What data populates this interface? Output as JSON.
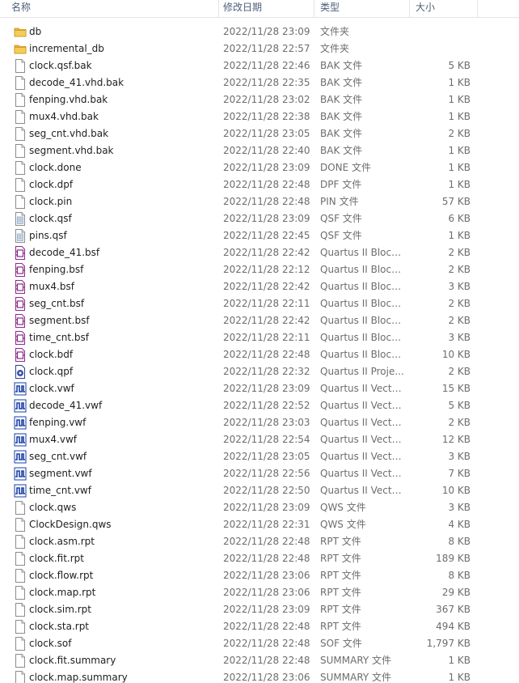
{
  "columns": {
    "name": "名称",
    "date": "修改日期",
    "type": "类型",
    "size": "大小"
  },
  "colors": {
    "header_text": "#4c607a",
    "folder": "#e8b53a",
    "vwf_icon": "#1a3fa8",
    "bsf_icon": "#8a2a8a"
  },
  "files": [
    {
      "name": "db",
      "date": "2022/11/28 23:09",
      "type": "文件夹",
      "size": "",
      "icon": "folder-icon"
    },
    {
      "name": "incremental_db",
      "date": "2022/11/28 22:57",
      "type": "文件夹",
      "size": "",
      "icon": "folder-icon"
    },
    {
      "name": "clock.qsf.bak",
      "date": "2022/11/28 22:46",
      "type": "BAK 文件",
      "size": "5 KB",
      "icon": "file-icon"
    },
    {
      "name": "decode_41.vhd.bak",
      "date": "2022/11/28 22:35",
      "type": "BAK 文件",
      "size": "1 KB",
      "icon": "file-icon"
    },
    {
      "name": "fenping.vhd.bak",
      "date": "2022/11/28 23:02",
      "type": "BAK 文件",
      "size": "1 KB",
      "icon": "file-icon"
    },
    {
      "name": "mux4.vhd.bak",
      "date": "2022/11/28 22:38",
      "type": "BAK 文件",
      "size": "1 KB",
      "icon": "file-icon"
    },
    {
      "name": "seg_cnt.vhd.bak",
      "date": "2022/11/28 23:05",
      "type": "BAK 文件",
      "size": "2 KB",
      "icon": "file-icon"
    },
    {
      "name": "segment.vhd.bak",
      "date": "2022/11/28 22:40",
      "type": "BAK 文件",
      "size": "1 KB",
      "icon": "file-icon"
    },
    {
      "name": "clock.done",
      "date": "2022/11/28 23:09",
      "type": "DONE 文件",
      "size": "1 KB",
      "icon": "file-icon"
    },
    {
      "name": "clock.dpf",
      "date": "2022/11/28 22:48",
      "type": "DPF 文件",
      "size": "1 KB",
      "icon": "file-icon"
    },
    {
      "name": "clock.pin",
      "date": "2022/11/28 22:48",
      "type": "PIN 文件",
      "size": "57 KB",
      "icon": "file-icon"
    },
    {
      "name": "clock.qsf",
      "date": "2022/11/28 23:09",
      "type": "QSF 文件",
      "size": "6 KB",
      "icon": "text-file-icon"
    },
    {
      "name": "pins.qsf",
      "date": "2022/11/28 22:45",
      "type": "QSF 文件",
      "size": "1 KB",
      "icon": "text-file-icon"
    },
    {
      "name": "decode_41.bsf",
      "date": "2022/11/28 22:42",
      "type": "Quartus II Block...",
      "size": "2 KB",
      "icon": "block-symbol-icon"
    },
    {
      "name": "fenping.bsf",
      "date": "2022/11/28 22:12",
      "type": "Quartus II Block...",
      "size": "2 KB",
      "icon": "block-symbol-icon"
    },
    {
      "name": "mux4.bsf",
      "date": "2022/11/28 22:42",
      "type": "Quartus II Block...",
      "size": "3 KB",
      "icon": "block-symbol-icon"
    },
    {
      "name": "seg_cnt.bsf",
      "date": "2022/11/28 22:11",
      "type": "Quartus II Block...",
      "size": "2 KB",
      "icon": "block-symbol-icon"
    },
    {
      "name": "segment.bsf",
      "date": "2022/11/28 22:42",
      "type": "Quartus II Block...",
      "size": "2 KB",
      "icon": "block-symbol-icon"
    },
    {
      "name": "time_cnt.bsf",
      "date": "2022/11/28 22:11",
      "type": "Quartus II Block...",
      "size": "3 KB",
      "icon": "block-symbol-icon"
    },
    {
      "name": "clock.bdf",
      "date": "2022/11/28 22:48",
      "type": "Quartus II Block...",
      "size": "10 KB",
      "icon": "block-symbol-icon"
    },
    {
      "name": "clock.qpf",
      "date": "2022/11/28 22:32",
      "type": "Quartus II Proje...",
      "size": "2 KB",
      "icon": "project-file-icon"
    },
    {
      "name": "clock.vwf",
      "date": "2022/11/28 23:09",
      "type": "Quartus II Vecto...",
      "size": "15 KB",
      "icon": "waveform-icon"
    },
    {
      "name": "decode_41.vwf",
      "date": "2022/11/28 22:52",
      "type": "Quartus II Vecto...",
      "size": "5 KB",
      "icon": "waveform-icon"
    },
    {
      "name": "fenping.vwf",
      "date": "2022/11/28 23:03",
      "type": "Quartus II Vecto...",
      "size": "2 KB",
      "icon": "waveform-icon"
    },
    {
      "name": "mux4.vwf",
      "date": "2022/11/28 22:54",
      "type": "Quartus II Vecto...",
      "size": "12 KB",
      "icon": "waveform-icon"
    },
    {
      "name": "seg_cnt.vwf",
      "date": "2022/11/28 23:05",
      "type": "Quartus II Vecto...",
      "size": "3 KB",
      "icon": "waveform-icon"
    },
    {
      "name": "segment.vwf",
      "date": "2022/11/28 22:56",
      "type": "Quartus II Vecto...",
      "size": "7 KB",
      "icon": "waveform-icon"
    },
    {
      "name": "time_cnt.vwf",
      "date": "2022/11/28 22:50",
      "type": "Quartus II Vecto...",
      "size": "10 KB",
      "icon": "waveform-icon"
    },
    {
      "name": "clock.qws",
      "date": "2022/11/28 23:09",
      "type": "QWS 文件",
      "size": "3 KB",
      "icon": "file-icon"
    },
    {
      "name": "ClockDesign.qws",
      "date": "2022/11/28 22:31",
      "type": "QWS 文件",
      "size": "4 KB",
      "icon": "file-icon"
    },
    {
      "name": "clock.asm.rpt",
      "date": "2022/11/28 22:48",
      "type": "RPT 文件",
      "size": "8 KB",
      "icon": "file-icon"
    },
    {
      "name": "clock.fit.rpt",
      "date": "2022/11/28 22:48",
      "type": "RPT 文件",
      "size": "189 KB",
      "icon": "file-icon"
    },
    {
      "name": "clock.flow.rpt",
      "date": "2022/11/28 23:06",
      "type": "RPT 文件",
      "size": "8 KB",
      "icon": "file-icon"
    },
    {
      "name": "clock.map.rpt",
      "date": "2022/11/28 23:06",
      "type": "RPT 文件",
      "size": "29 KB",
      "icon": "file-icon"
    },
    {
      "name": "clock.sim.rpt",
      "date": "2022/11/28 23:09",
      "type": "RPT 文件",
      "size": "367 KB",
      "icon": "file-icon"
    },
    {
      "name": "clock.sta.rpt",
      "date": "2022/11/28 22:48",
      "type": "RPT 文件",
      "size": "494 KB",
      "icon": "file-icon"
    },
    {
      "name": "clock.sof",
      "date": "2022/11/28 22:48",
      "type": "SOF 文件",
      "size": "1,797 KB",
      "icon": "file-icon"
    },
    {
      "name": "clock.fit.summary",
      "date": "2022/11/28 22:48",
      "type": "SUMMARY 文件",
      "size": "1 KB",
      "icon": "file-icon"
    },
    {
      "name": "clock.map.summary",
      "date": "2022/11/28 23:06",
      "type": "SUMMARY 文件",
      "size": "1 KB",
      "icon": "file-icon"
    }
  ]
}
